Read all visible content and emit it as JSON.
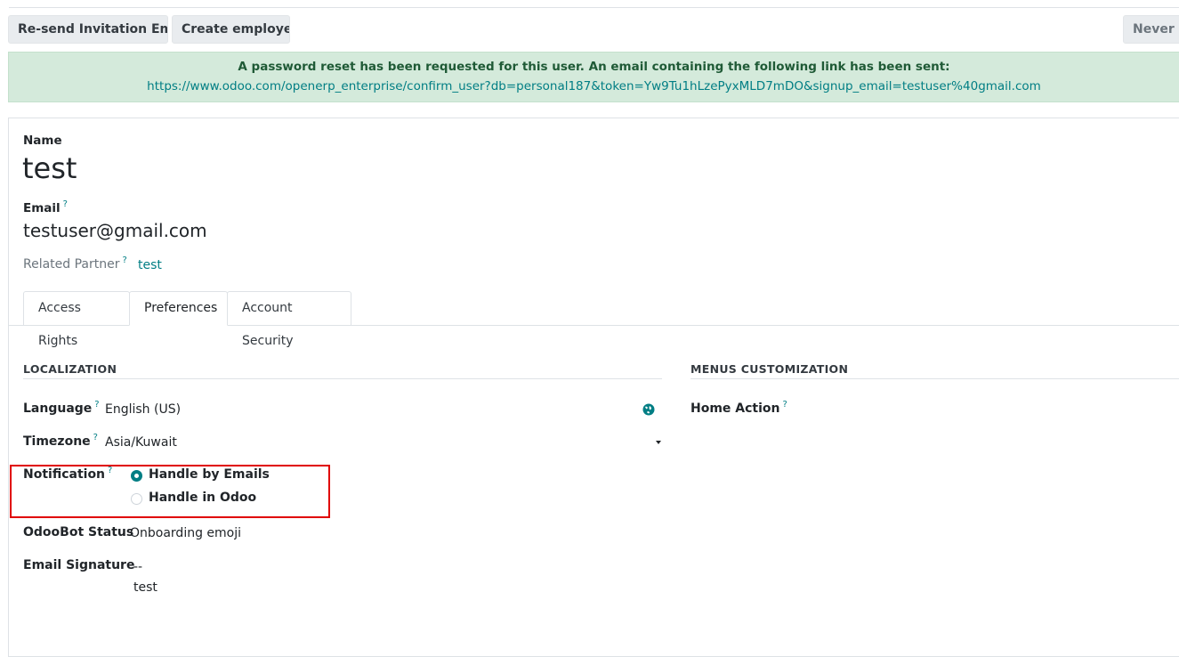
{
  "toolbar": {
    "resend_label": "Re-send Invitation Email",
    "create_employee_label": "Create employee",
    "never_label": "Never C"
  },
  "alert": {
    "message": "A password reset has been requested for this user. An email containing the following link has been sent:",
    "link": "https://www.odoo.com/openerp_enterprise/confirm_user?db=personal187&token=Yw9Tu1hLzePyxMLD7mDO&signup_email=testuser%40gmail.com"
  },
  "form": {
    "name_label": "Name",
    "name_value": "test",
    "email_label": "Email",
    "email_value": "testuser@gmail.com",
    "related_partner_label": "Related Partner",
    "related_partner_value": "test",
    "help_mark": "?"
  },
  "tabs": [
    {
      "label": "Access Rights"
    },
    {
      "label": "Preferences"
    },
    {
      "label": "Account Security"
    }
  ],
  "localization": {
    "title": "LOCALIZATION",
    "language_label": "Language",
    "language_value": "English (US)",
    "timezone_label": "Timezone",
    "timezone_value": "Asia/Kuwait",
    "notification_label": "Notification",
    "notification_options": [
      "Handle by Emails",
      "Handle in Odoo"
    ],
    "notification_selected": "Handle by Emails",
    "odoobot_label": "OdooBot Status",
    "odoobot_value": "Onboarding emoji",
    "signature_label": "Email Signature",
    "signature_line1": "--",
    "signature_line2": "test"
  },
  "menus": {
    "title": "MENUS CUSTOMIZATION",
    "home_action_label": "Home Action"
  },
  "colors": {
    "accent": "#017e84",
    "alert_bg": "#d4eadb",
    "highlight": "#e00000"
  },
  "icons": {
    "language": "globe-icon",
    "timezone": "caret-down-icon"
  }
}
